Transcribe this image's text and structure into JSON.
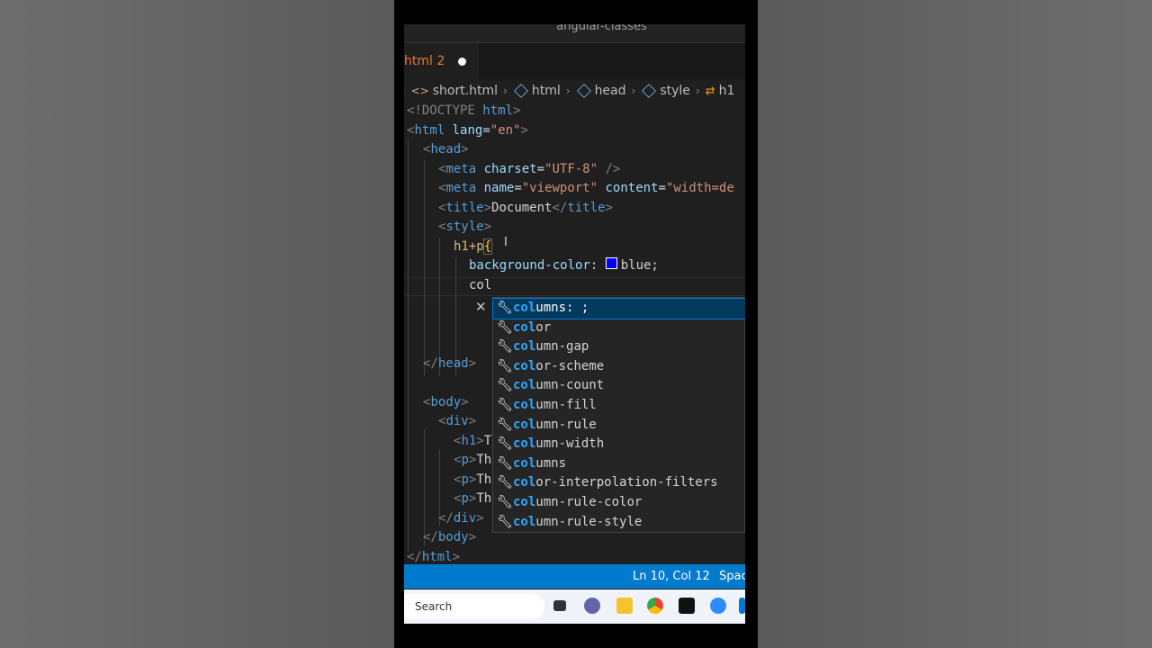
{
  "window": {
    "title": "angular-classes"
  },
  "tab": {
    "label": "html 2"
  },
  "breadcrumbs": [
    {
      "label": "short.html",
      "icon": "html-file-icon"
    },
    {
      "label": "html",
      "icon": "element-cube-icon"
    },
    {
      "label": "head",
      "icon": "element-cube-icon"
    },
    {
      "label": "style",
      "icon": "element-cube-icon"
    },
    {
      "label": "h1",
      "icon": "selector-icon"
    }
  ],
  "code": {
    "l1": {
      "a": "<!DOCTYPE ",
      "b": "html",
      "c": ">"
    },
    "l2": {
      "a": "<",
      "b": "html",
      "c": " lang",
      "d": "=",
      "e": "\"en\"",
      "f": ">"
    },
    "l3": {
      "a": "<",
      "b": "head",
      "c": ">"
    },
    "l4": {
      "a": "<",
      "b": "meta",
      "c": " charset",
      "d": "=",
      "e": "\"UTF-8\"",
      "f": " />"
    },
    "l5": {
      "a": "<",
      "b": "meta",
      "c": " name",
      "d": "=",
      "e": "\"viewport\"",
      "f": " content",
      "g": "=",
      "h": "\"width=de"
    },
    "l6": {
      "a": "<",
      "b": "title",
      "c": ">",
      "d": "Document",
      "e": "</",
      "f": "title",
      "g": ">"
    },
    "l7": {
      "a": "<",
      "b": "style",
      "c": ">"
    },
    "l8": {
      "a": "h1+p",
      "b": "{"
    },
    "l9": {
      "a": "background-color",
      "b": ": ",
      "c": "blue;"
    },
    "l10": {
      "a": "col"
    },
    "l11": {
      "a": "</",
      "b": "head",
      "c": ">"
    },
    "l12": {
      "a": "<",
      "b": "body",
      "c": ">"
    },
    "l13": {
      "a": "<",
      "b": "div",
      "c": ">"
    },
    "l14": {
      "a": "<",
      "b": "h1",
      "c": ">",
      "d": "T"
    },
    "l15": {
      "a": "<",
      "b": "p",
      "c": ">",
      "d": "Th"
    },
    "l16": {
      "a": "<",
      "b": "p",
      "c": ">",
      "d": "Th"
    },
    "l17": {
      "a": "<",
      "b": "p",
      "c": ">",
      "d": "Th"
    },
    "l18": {
      "a": "</",
      "b": "div",
      "c": ">"
    },
    "l19": {
      "a": "</",
      "b": "body",
      "c": ">"
    },
    "l20": {
      "a": "</",
      "b": "html",
      "c": ">"
    }
  },
  "swatch_color": "#0000ff",
  "suggestions": {
    "typed": "col",
    "items": [
      {
        "hl": "col",
        "rest": "umns: ;"
      },
      {
        "hl": "col",
        "rest": "or"
      },
      {
        "hl": "col",
        "rest": "umn-gap"
      },
      {
        "hl": "col",
        "rest": "or-scheme"
      },
      {
        "hl": "col",
        "rest": "umn-count"
      },
      {
        "hl": "col",
        "rest": "umn-fill"
      },
      {
        "hl": "col",
        "rest": "umn-rule"
      },
      {
        "hl": "col",
        "rest": "umn-width"
      },
      {
        "hl": "col",
        "rest": "umns"
      },
      {
        "hl": "col",
        "rest": "or-interpolation-filters"
      },
      {
        "hl": "col",
        "rest": "umn-rule-color"
      },
      {
        "hl": "col",
        "rest": "umn-rule-style"
      }
    ]
  },
  "status": {
    "position": "Ln 10, Col 12",
    "spaces": "Spac"
  },
  "taskbar": {
    "search_placeholder": "Search"
  }
}
